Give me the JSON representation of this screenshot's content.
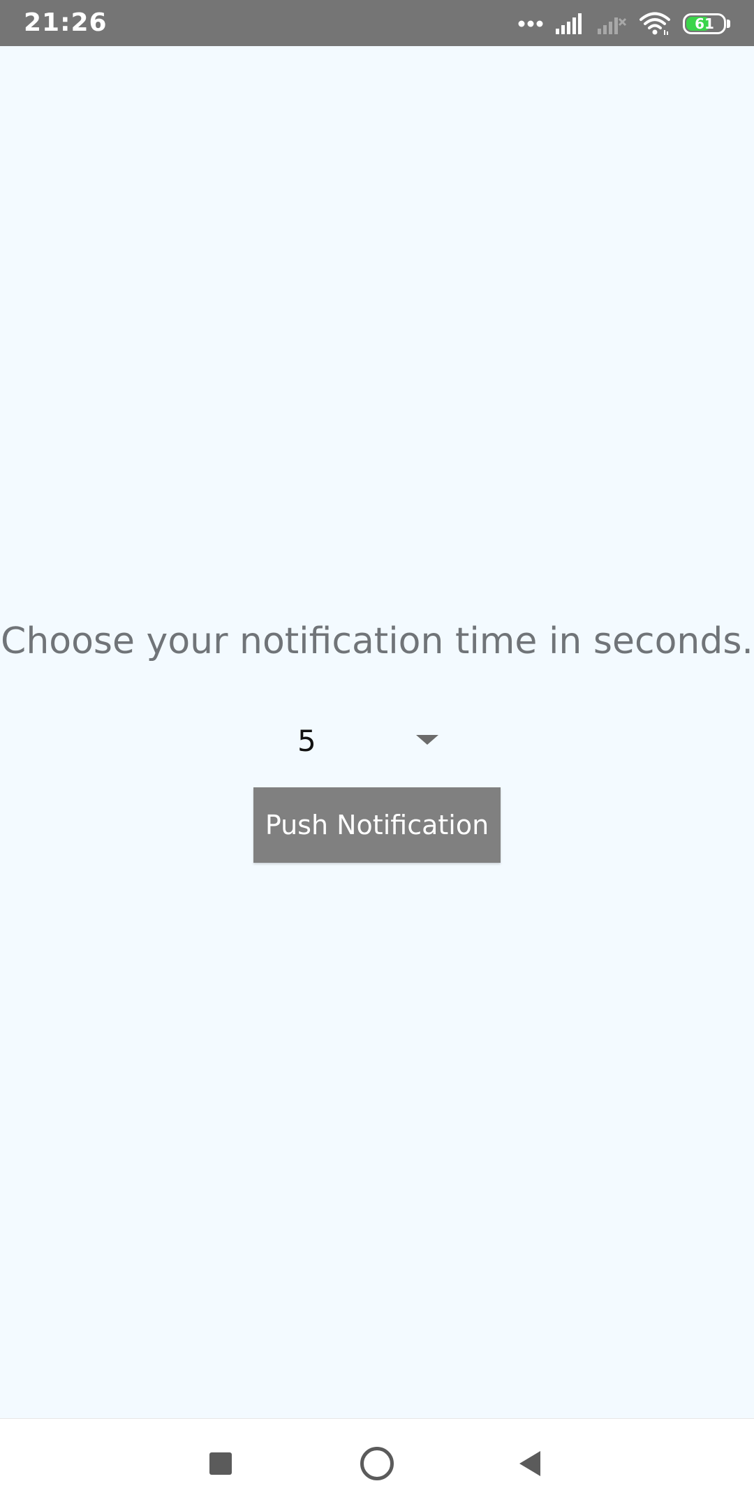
{
  "status_bar": {
    "time": "21:26",
    "battery_level": "61",
    "icons": [
      "more-dots-icon",
      "signal-icon",
      "signal-no-service-icon",
      "wifi-icon",
      "battery-icon"
    ]
  },
  "main": {
    "prompt": "Choose your notification time in seconds.",
    "spinner": {
      "selected_value": "5"
    },
    "push_button_label": "Push Notification"
  },
  "navigation_bar": {
    "icons": [
      "recent-apps-icon",
      "home-icon",
      "back-icon"
    ]
  },
  "colors": {
    "background": "#f3faff",
    "status_bar": "#757575",
    "button": "#808080",
    "battery_fill": "#3bd44a",
    "prompt_text": "#707478"
  }
}
